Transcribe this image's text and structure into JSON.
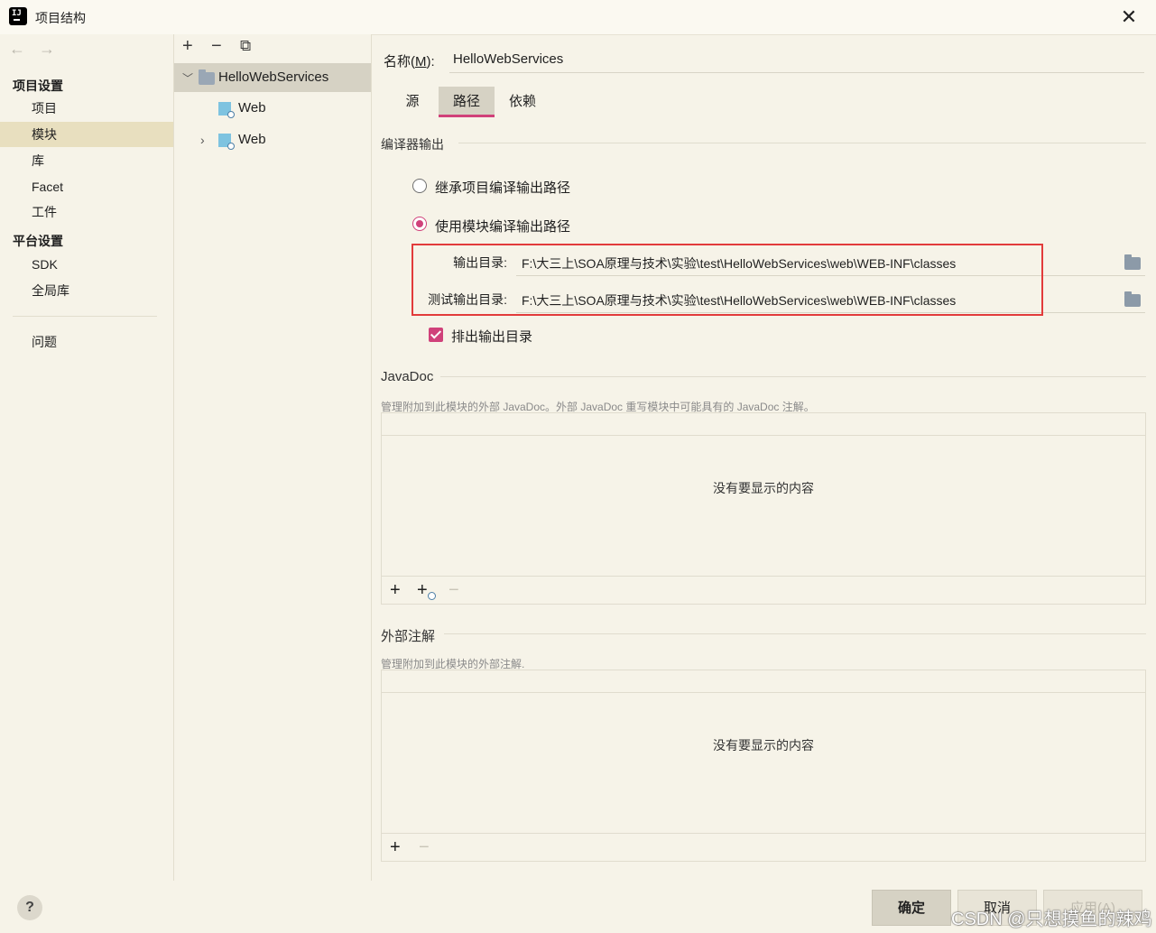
{
  "window": {
    "title": "项目结构",
    "close": "✕"
  },
  "nav": {
    "back": "←",
    "forward": "→",
    "project_settings_header": "项目设置",
    "items": [
      "项目",
      "模块",
      "库",
      "Facet",
      "工件"
    ],
    "platform_header": "平台设置",
    "platform_items": [
      "SDK",
      "全局库"
    ],
    "problems": "问题",
    "selected": "模块"
  },
  "tree": {
    "toolbar": {
      "add": "+",
      "remove": "−",
      "copy": "⧉"
    },
    "root": "HelloWebServices",
    "children": [
      "Web",
      "Web"
    ]
  },
  "module": {
    "name_label_prefix": "名称(",
    "name_label_mnemonic": "M",
    "name_label_suffix": "):",
    "name_value": "HelloWebServices",
    "tabs": [
      "源",
      "路径",
      "依赖"
    ],
    "active_tab": "路径"
  },
  "compiler_output": {
    "title": "编译器输出",
    "inherit_label": "继承项目编译输出路径",
    "use_module_label": "使用模块编译输出路径",
    "selected": "use_module",
    "output_dir_label": "输出目录:",
    "output_dir_value": "F:\\大三上\\SOA原理与技术\\实验\\test\\HelloWebServices\\web\\WEB-INF\\classes",
    "test_output_dir_label": "测试输出目录:",
    "test_output_dir_value": "F:\\大三上\\SOA原理与技术\\实验\\test\\HelloWebServices\\web\\WEB-INF\\classes",
    "exclude_label": "排出输出目录",
    "exclude_checked": true
  },
  "javadoc": {
    "title": "JavaDoc",
    "description": "管理附加到此模块的外部 JavaDoc。外部 JavaDoc 重写模块中可能具有的 JavaDoc 注解。",
    "empty": "没有要显示的内容",
    "toolbar": {
      "add": "+",
      "add_url": "+",
      "remove": "−"
    }
  },
  "external_annotations": {
    "title": "外部注解",
    "description": "管理附加到此模块的外部注解.",
    "empty": "没有要显示的内容",
    "toolbar": {
      "add": "+",
      "remove": "−"
    }
  },
  "buttons": {
    "help": "?",
    "ok": "确定",
    "cancel": "取消",
    "apply": "应用(A)"
  },
  "watermark": "CSDN @只想摸鱼的辣鸡",
  "colors": {
    "accent": "#d0417a",
    "highlight_box": "#e23b3b",
    "background": "#f6f3e8",
    "selection": "#e8dfbf"
  }
}
